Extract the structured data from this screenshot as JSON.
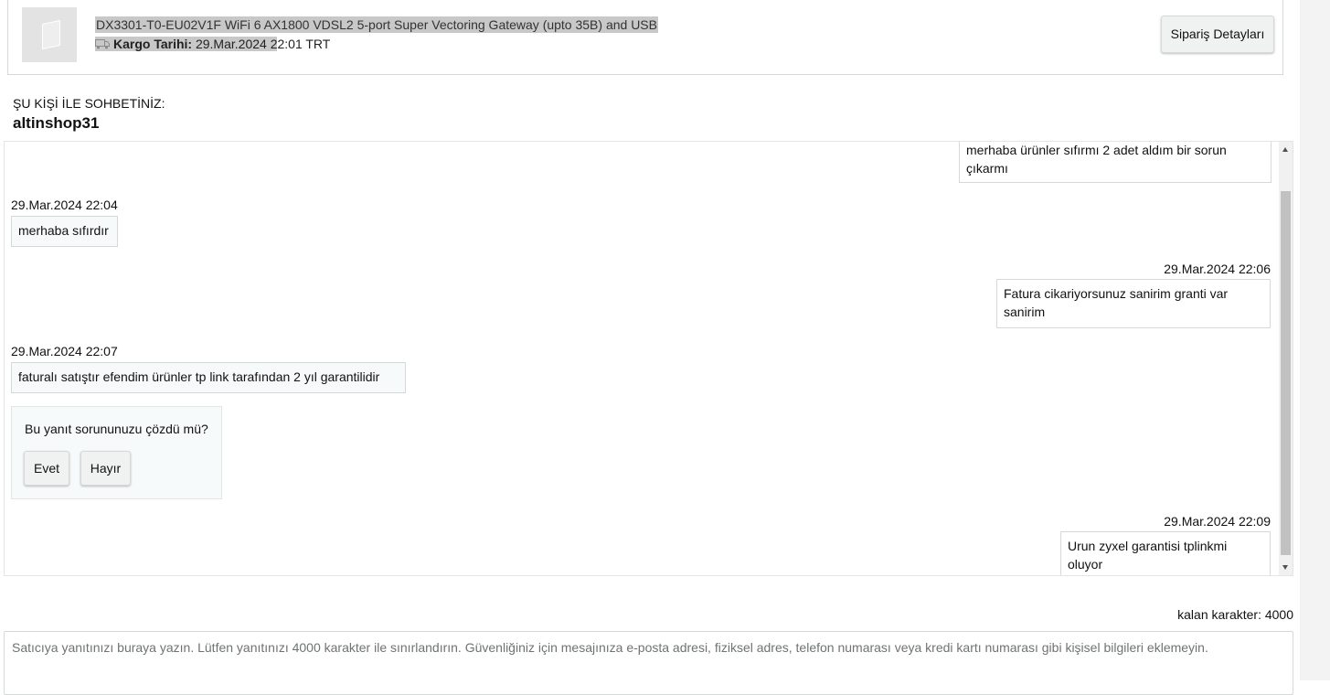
{
  "order": {
    "product_title": "DX3301-T0-EU02V1F WiFi 6 AX1800 VDSL2 5-port Super Vectoring Gateway (upto 35B) and USB",
    "shipping_label": "Kargo Tarihi:",
    "shipping_date_highlighted": "29.Mar.2024 2",
    "shipping_date_rest": "2:01 TRT",
    "order_details_button": "Sipariş Detayları"
  },
  "conversation": {
    "with_label": "ŞU KİŞİ İLE SOHBETİNİZ:",
    "seller_name": "altinshop31"
  },
  "messages": [
    {
      "direction": "outgoing",
      "timestamp": "",
      "text": "merhaba ürünler sıfırmı 2 adet aldım bir sorun çıkarmı"
    },
    {
      "direction": "incoming",
      "timestamp": "29.Mar.2024 22:04",
      "text": "merhaba sıfırdır"
    },
    {
      "direction": "outgoing",
      "timestamp": "29.Mar.2024 22:06",
      "text": "Fatura cikariyorsunuz sanirim granti var sanirim"
    },
    {
      "direction": "incoming",
      "timestamp": "29.Mar.2024 22:07",
      "text": "faturalı satıştır efendim ürünler tp link tarafından 2 yıl garantilidir"
    },
    {
      "direction": "outgoing",
      "timestamp": "29.Mar.2024 22:09",
      "text": "Urun zyxel garantisi tplinkmi oluyor"
    }
  ],
  "feedback": {
    "question": "Bu yanıt sorununuzu çözdü mü?",
    "yes_label": "Evet",
    "no_label": "Hayır"
  },
  "reply": {
    "char_count_label": "kalan karakter: 4000",
    "placeholder": "Satıcıya yanıtınızı buraya yazın. Lütfen yanıtınızı 4000 karakter ile sınırlandırın. Güvenliğiniz için mesajınıza e-posta adresi, fiziksel adres, telefon numarası veya kredi kartı numarası gibi kişisel bilgileri eklemeyin.",
    "value": ""
  },
  "colors": {
    "highlight": "#c8c8c8",
    "bubble_incoming_bg": "#f7fafa",
    "border": "#d5d9d9",
    "button_bg": "#f0f2f2"
  }
}
